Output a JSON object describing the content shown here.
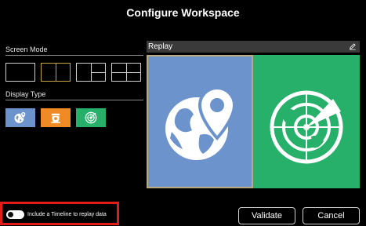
{
  "dialog": {
    "title": "Configure Workspace"
  },
  "screen_mode": {
    "label": "Screen Mode",
    "options": [
      "1x1",
      "2 columns",
      "1 + 2 split",
      "2x2"
    ],
    "selected": "2 columns"
  },
  "display_type": {
    "label": "Display Type",
    "items": [
      {
        "icon": "globe-pin-icon",
        "color": "#6c93cc"
      },
      {
        "icon": "dome-camera-icon",
        "color": "#f08a24"
      },
      {
        "icon": "radar-icon",
        "color": "#26b06a"
      }
    ]
  },
  "preview": {
    "title": "Replay",
    "tiles": [
      {
        "icon": "globe-pin-icon",
        "color": "#6c93cc"
      },
      {
        "icon": "radar-icon",
        "color": "#26b06a"
      }
    ]
  },
  "timeline": {
    "label": "Include a Timeline to replay data",
    "enabled": true
  },
  "buttons": {
    "validate": "Validate",
    "cancel": "Cancel"
  },
  "colors": {
    "highlight": "#e21b1b",
    "selected_mode": "#c9a24a"
  }
}
